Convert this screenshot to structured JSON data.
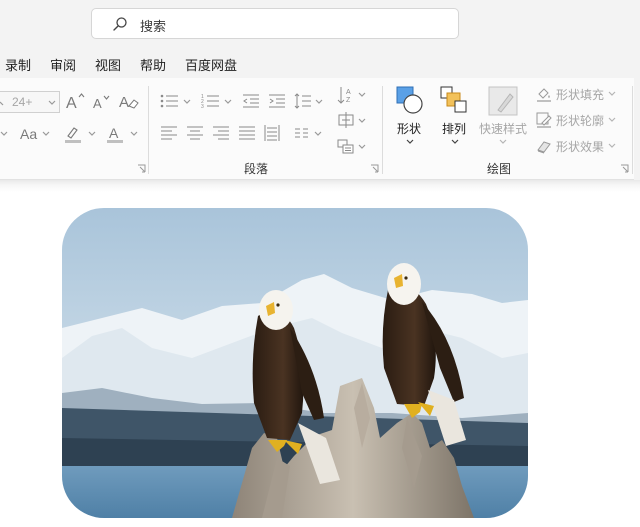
{
  "search": {
    "text": "搜索",
    "icon": "search-icon"
  },
  "menu": {
    "items": [
      "录制",
      "审阅",
      "视图",
      "帮助",
      "百度网盘"
    ]
  },
  "ribbon": {
    "font": {
      "size_value": "24+",
      "buttons": [
        "increase-font-size-icon",
        "decrease-font-size-icon",
        "clear-formatting-icon",
        "change-case-icon",
        "highlight-icon",
        "font-color-icon"
      ],
      "case_label": "Aa",
      "highlight_color": "#c0c0c0",
      "font_color": "#c0c0c0"
    },
    "paragraph": {
      "label": "段落"
    },
    "drawing": {
      "label": "绘图",
      "shape_label": "形状",
      "arrange_label": "排列",
      "quick_styles_label": "快速样式",
      "fill_label": "形状填充",
      "outline_label": "形状轮廓",
      "effects_label": "形状效果"
    }
  },
  "document": {
    "image_subject": "two-eagles-photo"
  },
  "colors": {
    "shape_fill": "#5aa0e6",
    "arrange_back": "#f2c15a",
    "disabled": "#a6a6a6"
  }
}
